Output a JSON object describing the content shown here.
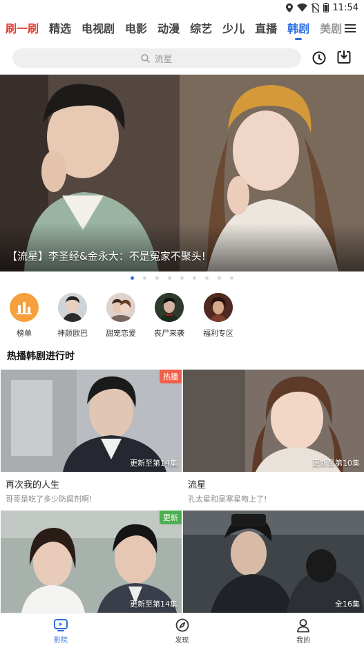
{
  "status_bar": {
    "time": "11:54"
  },
  "tabs": [
    {
      "label": "刷一刷"
    },
    {
      "label": "精选"
    },
    {
      "label": "电视剧"
    },
    {
      "label": "电影"
    },
    {
      "label": "动漫"
    },
    {
      "label": "综艺"
    },
    {
      "label": "少儿"
    },
    {
      "label": "直播"
    },
    {
      "label": "韩剧"
    },
    {
      "label": "美剧"
    }
  ],
  "active_tab": "韩剧",
  "search": {
    "placeholder": "流星"
  },
  "banner": {
    "caption": "【流星】李圣经&金永大：不是冤家不聚头!"
  },
  "carousel": {
    "count": 9,
    "active_index": 0
  },
  "quick_entries": [
    {
      "label": "榜单",
      "icon": "chart-bars-icon"
    },
    {
      "label": "神颜欧巴"
    },
    {
      "label": "甜宠恋爱"
    },
    {
      "label": "丧尸来袭"
    },
    {
      "label": "福利专区"
    }
  ],
  "section": {
    "title": "热播韩剧进行时"
  },
  "cards": [
    {
      "title": "再次我的人生",
      "subtitle": "哥哥是吃了多少防腐剂啊!",
      "episode": "更新至第14集",
      "badge": "热播"
    },
    {
      "title": "流星",
      "subtitle": "孔太星和吴寒星吻上了!",
      "episode": "更新至第10集",
      "badge": ""
    },
    {
      "title": "",
      "subtitle": "",
      "episode": "更新至第14集",
      "badge": "更新"
    },
    {
      "title": "",
      "subtitle": "",
      "episode": "全16集",
      "badge": ""
    }
  ],
  "bottom_nav": [
    {
      "label": "影院",
      "icon": "play-screen-icon"
    },
    {
      "label": "发现",
      "icon": "compass-icon"
    },
    {
      "label": "我的",
      "icon": "user-icon"
    }
  ],
  "colors": {
    "accent": "#2f6fe4",
    "brand_red": "#e8392f",
    "hot_badge": "#f0604a",
    "new_badge": "#4cb050",
    "chart_orange": "#f5a03c"
  }
}
